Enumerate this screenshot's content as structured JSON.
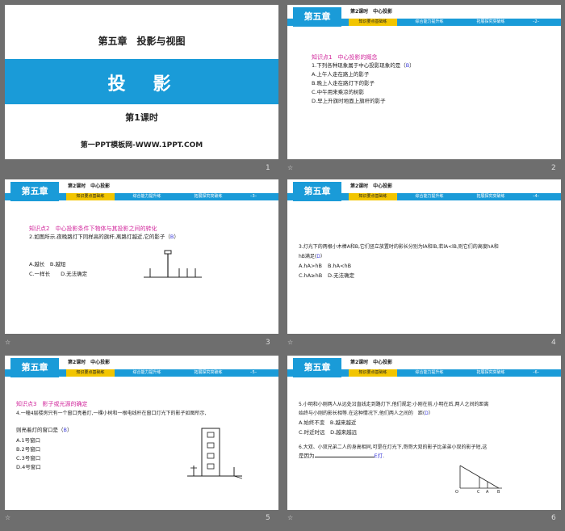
{
  "slides": [
    {
      "num": "1",
      "chapter": "第五章　投影与视图",
      "title": "投　影",
      "lesson": "第1课时",
      "source": "第一PPT模板网-WWW.1PPT.COM"
    },
    {
      "num": "2",
      "icon": "☆",
      "page": "–2–",
      "kp": "知识点1　中心投影的概念",
      "lines": [
        "1.下列各种现象属于中心投影现象的是（",
        "A.上午人走在路上的影子",
        "B.晚上人走在路灯下的影子",
        "C.中午用来乘凉的树影",
        "D.早上升旗时地面上旗杆的影子"
      ],
      "answer": "B"
    },
    {
      "num": "3",
      "icon": "☆",
      "page": "–3–",
      "kp": "知识点2　中心投影条件下物体与其投影之间的转化",
      "lines": [
        "2.如图所示,夜晚路灯下同样高的旗杆,离路灯越近,它的影子（",
        "A.越长　B.越短",
        "C.一样长　　D.无法确定"
      ],
      "answer": "B"
    },
    {
      "num": "4",
      "icon": "☆",
      "page": "–4–",
      "lines": [
        "3.灯光下的两根小木棒A和B,它们竖立放置时的影长分别为l",
        "A.h",
        "C.h"
      ],
      "q3": {
        "a": "A.hA>hB",
        "b": "B.hA<hB",
        "c": "C.hA≥hB",
        "d": "D.无法确定",
        "answer": "D",
        "stem1": "3.灯光下的两根小木棒A和B,它们竖立放置时的影长分别为lA和lB,若lA<lB,则它们的高度hA和",
        "stem2": "hB满足("
      }
    },
    {
      "num": "5",
      "icon": "☆",
      "page": "–5–",
      "kp": "知识点3　影子或光源的确定",
      "stem1": "4.一幢4层楼房只有一个窗口亮着灯,一棵小树和一根电线杆在窗口灯光下的影子如图所示,",
      "stem2": "则亮着灯的窗口是（",
      "opts": [
        "A.1号窗口",
        "B.2号窗口",
        "C.3号窗口",
        "D.4号窗口"
      ],
      "answer": "B"
    },
    {
      "num": "6",
      "icon": "☆",
      "page": "–6–",
      "q5a": "5.小明和小刚两人从远处沿直线走到路灯下,他们规定:小刚在前,小明在后,两人之间的距离",
      "q5b": "始终与小刚的影长相等.在这种情况下,他们两人之间的　距(",
      "q5ans": "D",
      "q5opts": [
        "A.始终不变　B.越来越近",
        "C.时近时远　D.越来越远"
      ],
      "q6a": "6.大双、小双兄弟二人的身高相同,可是在灯光下,哥哥大双的影子比弟弟小双的影子短,这",
      "q6b": "是因为",
      "q6ans": "E灯",
      "fig_labels": [
        "O",
        "C",
        "A",
        "B"
      ]
    }
  ],
  "header": {
    "chapter_tag": "第五章",
    "lesson": "第2课时　中心投影",
    "tabs": [
      "知识要点基础练",
      "综合能力提升练",
      "拓展探究突破练"
    ]
  },
  "colors": {
    "accent": "#1a9bd8",
    "highlight": "#f2c500",
    "kp": "#d1269b",
    "answer": "#3a3ad8"
  }
}
